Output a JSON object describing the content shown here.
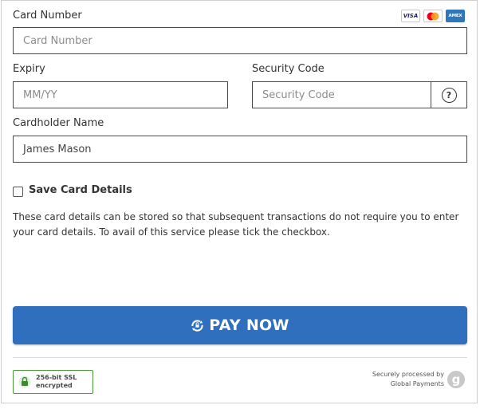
{
  "card_number": {
    "label": "Card Number",
    "placeholder": "Card Number",
    "logos": [
      "VISA",
      "mastercard",
      "AMEX"
    ]
  },
  "expiry": {
    "label": "Expiry",
    "placeholder": "MM/YY"
  },
  "security_code": {
    "label": "Security Code",
    "placeholder": "Security Code",
    "help_icon": "?"
  },
  "cardholder": {
    "label": "Cardholder Name",
    "value": "James Mason"
  },
  "save_card": {
    "label": "Save Card Details",
    "checked": false,
    "info": "These card details can be stored so that subsequent transactions do not require you to enter your card details. To avail of this service please tick the checkbox."
  },
  "pay_button": {
    "label": "PAY NOW",
    "icon": "pay-cycle-icon",
    "color": "#2f6fbd"
  },
  "footer": {
    "ssl_line1": "256-bit SSL",
    "ssl_line2": "encrypted",
    "secure_line1": "Securely processed by",
    "secure_line2": "Global Payments",
    "g_logo": "g"
  }
}
